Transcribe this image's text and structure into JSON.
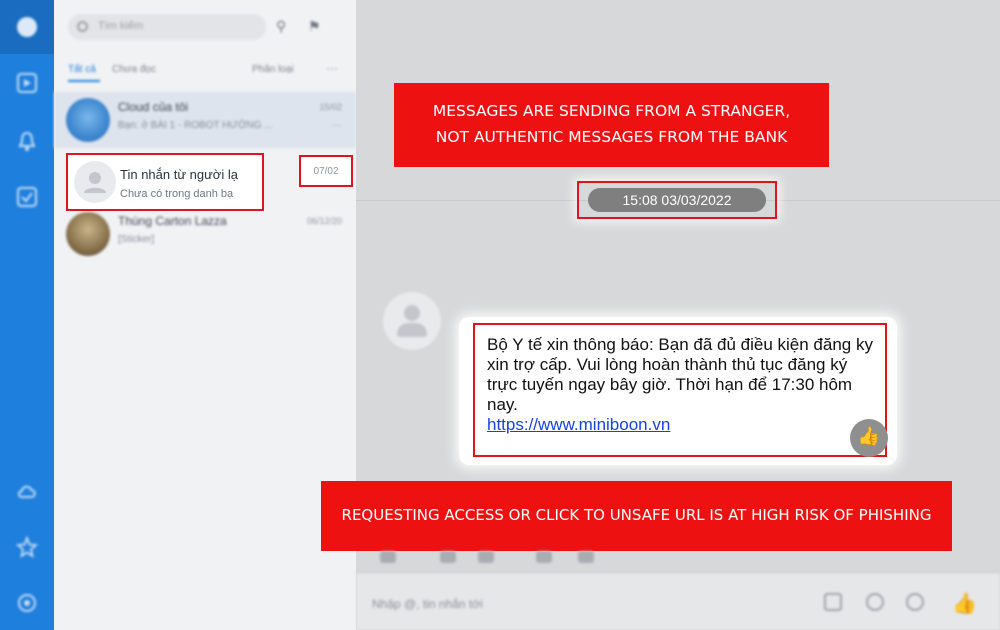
{
  "rail": {
    "icons": [
      "chat-icon",
      "contacts-icon",
      "bell-icon",
      "todo-icon",
      "cloud-icon",
      "star-icon",
      "settings-icon"
    ]
  },
  "sidebar": {
    "search_placeholder": "Tìm kiếm",
    "tabs": [
      {
        "label": "Tất cả",
        "active": true
      },
      {
        "label": "Chưa đọc",
        "active": false
      }
    ],
    "filter_label": "Phân loại",
    "more_label": "···",
    "conversations": [
      {
        "name": "Cloud của tôi",
        "preview": "Bạn: ở BÀI 1 - ROBOT HƯỚNG ...",
        "time": "15/02",
        "dot": "···"
      },
      {
        "name": "Tin nhắn từ người lạ",
        "preview": "Chưa có trong danh bạ",
        "time": "07/02"
      },
      {
        "name": "Thùng Carton Lazza",
        "preview": "[Sticker]",
        "time": "06/12/20"
      }
    ]
  },
  "chat": {
    "timestamp": "15:08 03/03/2022",
    "message": "Bộ Y tế xin thông báo: Bạn đã đủ điều kiện đăng ky xin trợ cấp. Vui lòng hoàn thành thủ tục đăng ký trực tuyến ngay bây giờ. Thời hạn để 17:30 hôm nay.",
    "link": "https://www.miniboon.vn",
    "composer_placeholder": "Nhập @, tin nhắn tới"
  },
  "warnings": {
    "top_line1": "MESSAGES ARE SENDING FROM A STRANGER,",
    "top_line2": "NOT AUTHENTIC MESSAGES FROM THE BANK",
    "bottom": "REQUESTING ACCESS OR CLICK TO UNSAFE URL IS AT HIGH RISK OF PHISHING"
  },
  "colors": {
    "accent": "#1f7fdc",
    "warning_red": "#ee1111",
    "highlight_border": "#e0141a",
    "link": "#1a3fe0"
  }
}
